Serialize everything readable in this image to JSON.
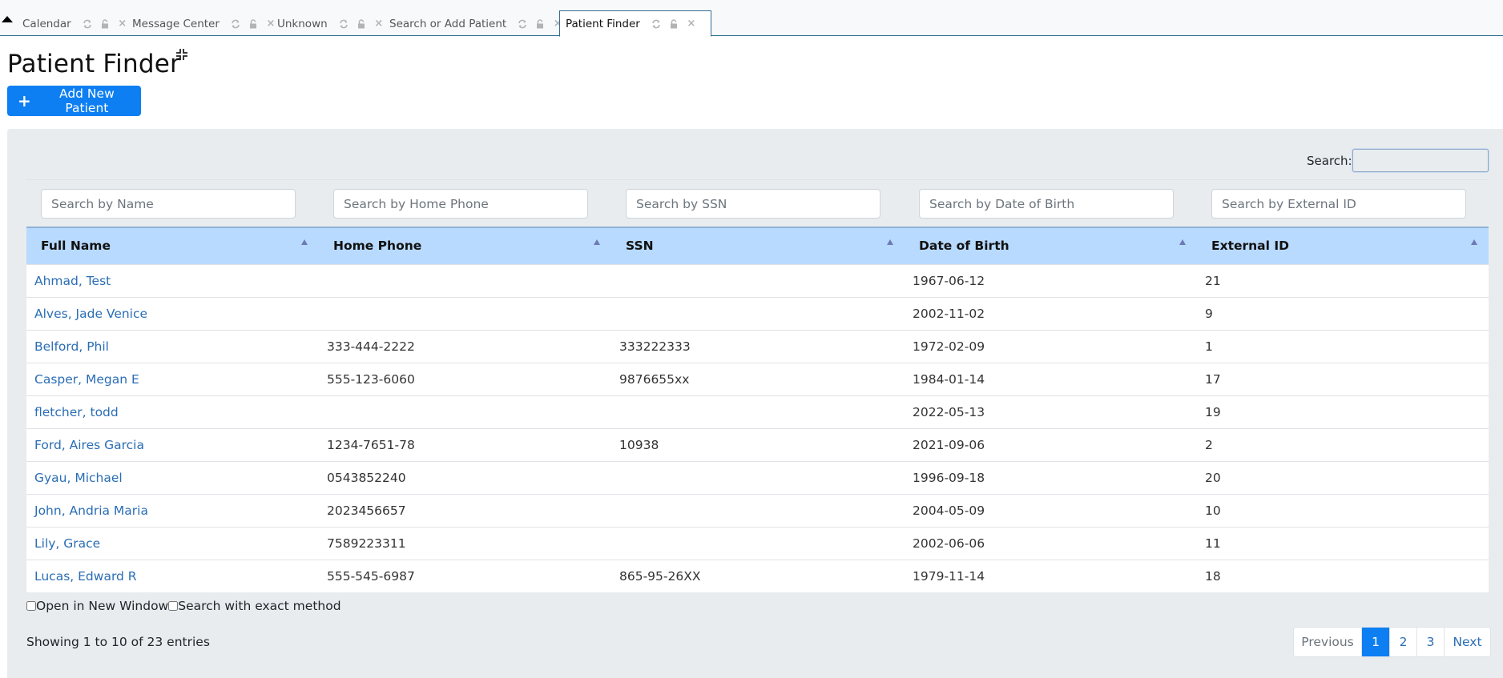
{
  "tabs": [
    {
      "label": "Calendar",
      "active": false
    },
    {
      "label": "Message Center",
      "active": false
    },
    {
      "label": "Unknown",
      "active": false
    },
    {
      "label": "Search or Add Patient",
      "active": false
    },
    {
      "label": "Patient Finder",
      "active": true
    }
  ],
  "tab_icons": [
    "refresh-icon",
    "lock-icon",
    "close-icon"
  ],
  "header": {
    "title": "Patient Finder",
    "add_button_label": "Add New Patient"
  },
  "search": {
    "label": "Search:",
    "value": ""
  },
  "filters": {
    "name_placeholder": "Search by Name",
    "phone_placeholder": "Search by Home Phone",
    "ssn_placeholder": "Search by SSN",
    "dob_placeholder": "Search by Date of Birth",
    "external_id_placeholder": "Search by External ID"
  },
  "table": {
    "columns": [
      "Full Name",
      "Home Phone",
      "SSN",
      "Date of Birth",
      "External ID"
    ],
    "rows": [
      {
        "name": "Ahmad, Test",
        "phone": "",
        "ssn": "",
        "dob": "1967-06-12",
        "external_id": "21"
      },
      {
        "name": "Alves, Jade Venice",
        "phone": "",
        "ssn": "",
        "dob": "2002-11-02",
        "external_id": "9"
      },
      {
        "name": "Belford, Phil",
        "phone": "333-444-2222",
        "ssn": "333222333",
        "dob": "1972-02-09",
        "external_id": "1"
      },
      {
        "name": "Casper, Megan E",
        "phone": "555-123-6060",
        "ssn": "9876655xx",
        "dob": "1984-01-14",
        "external_id": "17"
      },
      {
        "name": "fletcher, todd",
        "phone": "",
        "ssn": "",
        "dob": "2022-05-13",
        "external_id": "19"
      },
      {
        "name": "Ford, Aires Garcia",
        "phone": "1234-7651-78",
        "ssn": "10938",
        "dob": "2021-09-06",
        "external_id": "2"
      },
      {
        "name": "Gyau, Michael",
        "phone": "0543852240",
        "ssn": "",
        "dob": "1996-09-18",
        "external_id": "20"
      },
      {
        "name": "John, Andria Maria",
        "phone": "2023456657",
        "ssn": "",
        "dob": "2004-05-09",
        "external_id": "10"
      },
      {
        "name": "Lily, Grace",
        "phone": "7589223311",
        "ssn": "",
        "dob": "2002-06-06",
        "external_id": "11"
      },
      {
        "name": "Lucas, Edward R",
        "phone": "555-545-6987",
        "ssn": "865-95-26XX",
        "dob": "1979-11-14",
        "external_id": "18"
      }
    ]
  },
  "options": {
    "open_new_window_label": "Open in New Window",
    "open_new_window_checked": false,
    "exact_method_label": "Search with exact method",
    "exact_method_checked": false
  },
  "footer": {
    "entries_info": "Showing 1 to 10 of 23 entries"
  },
  "pagination": {
    "previous_label": "Previous",
    "pages": [
      "1",
      "2",
      "3"
    ],
    "current_page": "1",
    "next_label": "Next"
  },
  "colors": {
    "primary": "#0d7ff2",
    "table_header": "#b8daff",
    "panel_bg": "#e9ecef",
    "link": "#2a6db5"
  }
}
